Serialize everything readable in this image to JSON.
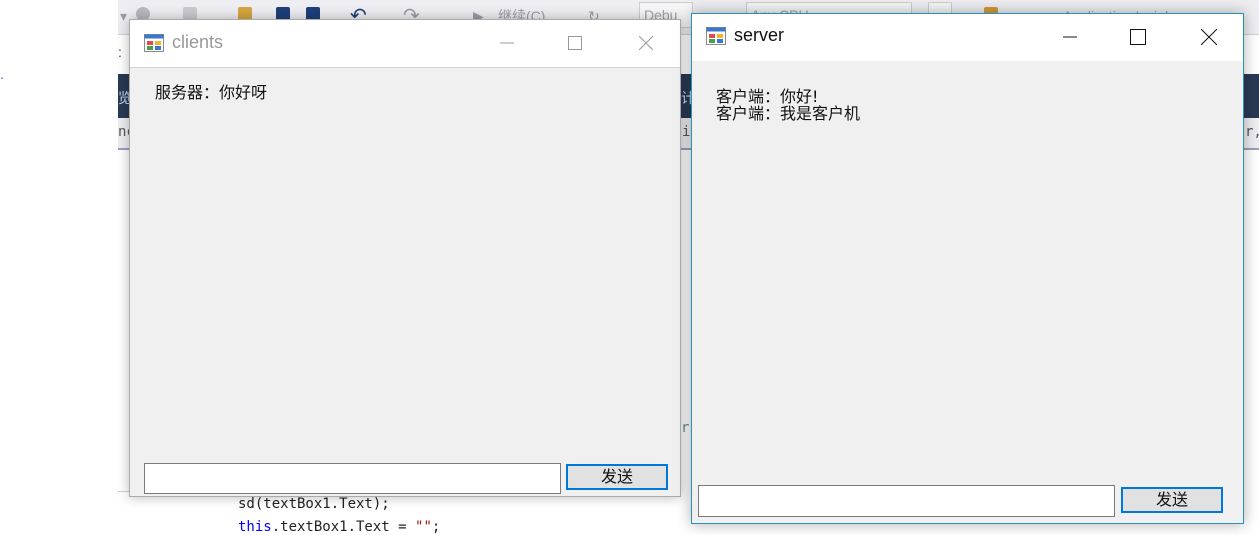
{
  "ide": {
    "toolbar_continue": "继续(C)",
    "toolbar_config": "Debu",
    "toolbar_platform": "Any CPU",
    "toolbar_startup": "Application Insigh",
    "left_fragments": [
      ":",
      "."
    ],
    "side_fragments": [
      "览",
      "nc",
      "计",
      "ie",
      "r,",
      "rs"
    ],
    "code_lines": [
      {
        "code": "sd(textBox1.Text);"
      },
      {
        "kw": "this",
        "code": ".textBox1.Text = ",
        "str": "\"\"",
        "end": ";"
      }
    ]
  },
  "clients": {
    "title": "clients",
    "icon": "form-app-icon",
    "messages": [
      "服务器：你好呀"
    ],
    "input_value": "",
    "send_label": "发送"
  },
  "server": {
    "title": "server",
    "icon": "form-app-icon",
    "messages": [
      "客户端：你好!",
      "客户端：我是客户机"
    ],
    "input_value": "",
    "send_label": "发送"
  },
  "colors": {
    "active_border": "#2a8fbd",
    "button_focus": "#0078d7",
    "window_bg": "#f0f0f0",
    "ide_dark": "#293955"
  }
}
